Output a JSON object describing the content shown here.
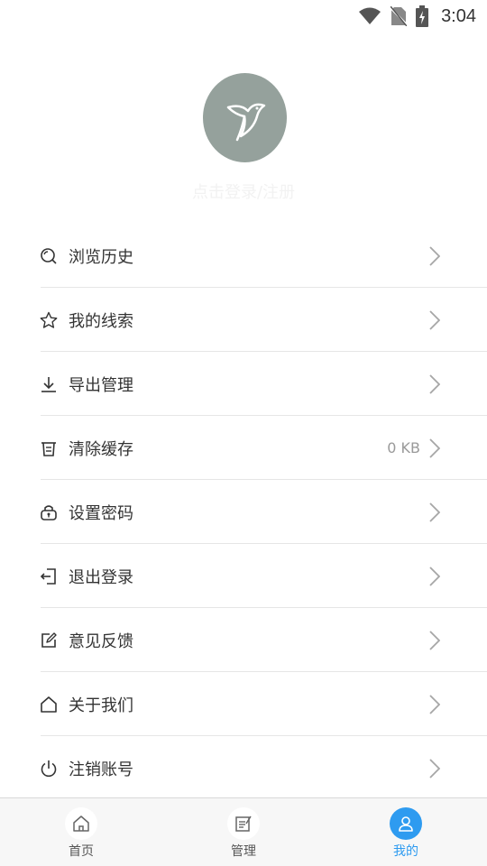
{
  "status_bar": {
    "time": "3:04"
  },
  "profile": {
    "login_prompt": "点击登录/注册"
  },
  "menu": [
    {
      "label": "浏览历史",
      "icon": "search-icon",
      "value": ""
    },
    {
      "label": "我的线索",
      "icon": "star-icon",
      "value": ""
    },
    {
      "label": "导出管理",
      "icon": "download-icon",
      "value": ""
    },
    {
      "label": "清除缓存",
      "icon": "trash-icon",
      "value": "0 KB"
    },
    {
      "label": "设置密码",
      "icon": "lock-icon",
      "value": ""
    },
    {
      "label": "退出登录",
      "icon": "logout-icon",
      "value": ""
    },
    {
      "label": "意见反馈",
      "icon": "edit-icon",
      "value": ""
    },
    {
      "label": "关于我们",
      "icon": "home-icon",
      "value": ""
    },
    {
      "label": "注销账号",
      "icon": "power-icon",
      "value": ""
    }
  ],
  "tabbar": {
    "tabs": [
      {
        "label": "首页",
        "icon": "home-icon"
      },
      {
        "label": "管理",
        "icon": "notepad-icon"
      },
      {
        "label": "我的",
        "icon": "user-icon",
        "active": true
      }
    ]
  },
  "colors": {
    "accent": "#2e9bf0",
    "avatar_bg": "#95a19c"
  }
}
